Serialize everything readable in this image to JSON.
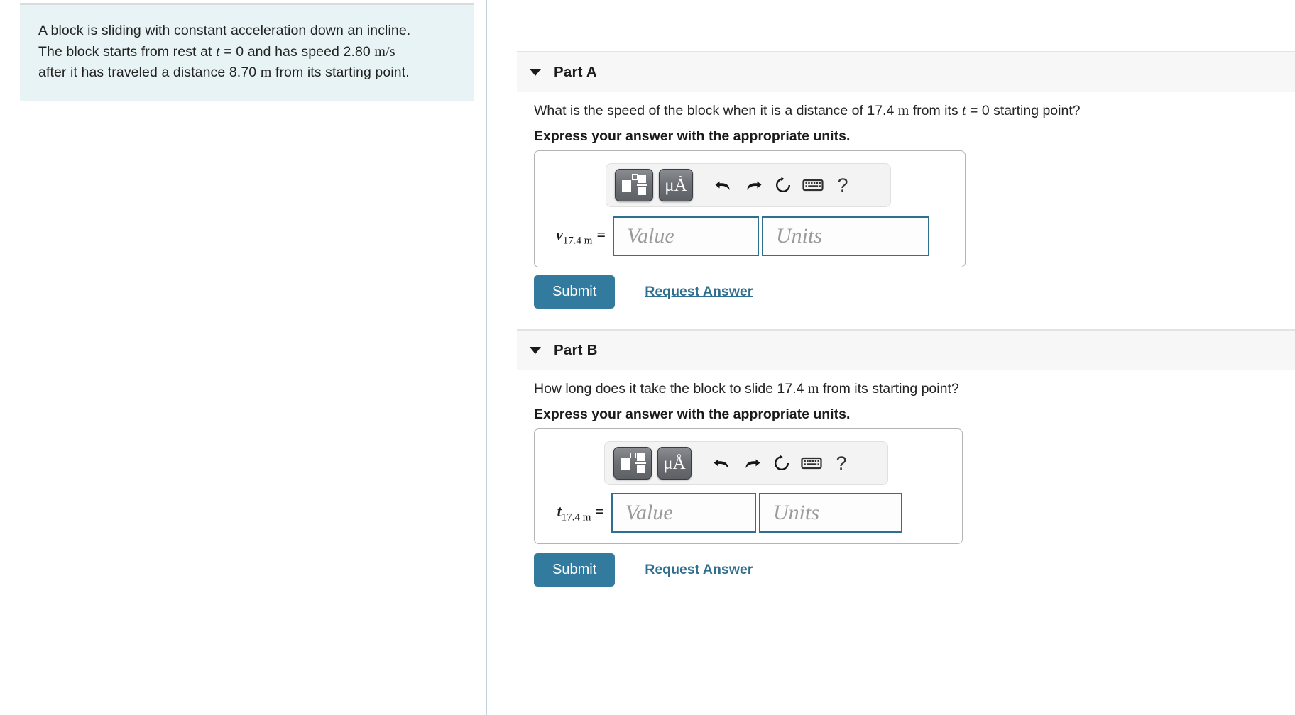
{
  "problem": {
    "statement_line1_a": "A block is sliding with constant acceleration down an incline.",
    "statement_line2_a": "The block starts from rest at ",
    "statement_line2_var": "t",
    "statement_line2_b": " = 0 and has speed 2.80 ",
    "statement_line2_units": "m/s",
    "statement_line3_a": "after it has traveled a distance 8.70 ",
    "statement_line3_units": "m",
    "statement_line3_b": " from its starting point."
  },
  "parts": [
    {
      "id": "A",
      "title": "Part A",
      "question_a": "What is the speed of the block when it is a distance of 17.4 ",
      "question_units": "m",
      "question_b": " from its ",
      "question_var": "t",
      "question_c": " = 0 starting point?",
      "express": "Express your answer with the appropriate units.",
      "variable_symbol": "v",
      "variable_subscript": "17.4 m",
      "equals": "=",
      "value_placeholder": "Value",
      "units_placeholder": "Units",
      "value_text": "",
      "units_text": "",
      "submit_label": "Submit",
      "request_label": "Request Answer",
      "toolbar": {
        "template_button": "math-template-button",
        "units_button": "μÅ",
        "undo": "undo-icon",
        "redo": "redo-icon",
        "reset": "reset-icon",
        "keyboard": "keyboard-icon",
        "help": "?"
      }
    },
    {
      "id": "B",
      "title": "Part B",
      "question_a": "How long does it take the block to slide 17.4 ",
      "question_units": "m",
      "question_b": " from its starting point?",
      "question_var": "",
      "question_c": "",
      "express": "Express your answer with the appropriate units.",
      "variable_symbol": "t",
      "variable_subscript": "17.4 m",
      "equals": "=",
      "value_placeholder": "Value",
      "units_placeholder": "Units",
      "value_text": "",
      "units_text": "",
      "submit_label": "Submit",
      "request_label": "Request Answer",
      "toolbar": {
        "template_button": "math-template-button",
        "units_button": "μÅ",
        "undo": "undo-icon",
        "redo": "redo-icon",
        "reset": "reset-icon",
        "keyboard": "keyboard-icon",
        "help": "?"
      }
    }
  ],
  "colors": {
    "statement_bg": "#e7f3f4",
    "part_header_bg": "#f7f7f7",
    "accent": "#337b9e",
    "input_border": "#2f6f8f",
    "divider": "#c3d3de"
  }
}
